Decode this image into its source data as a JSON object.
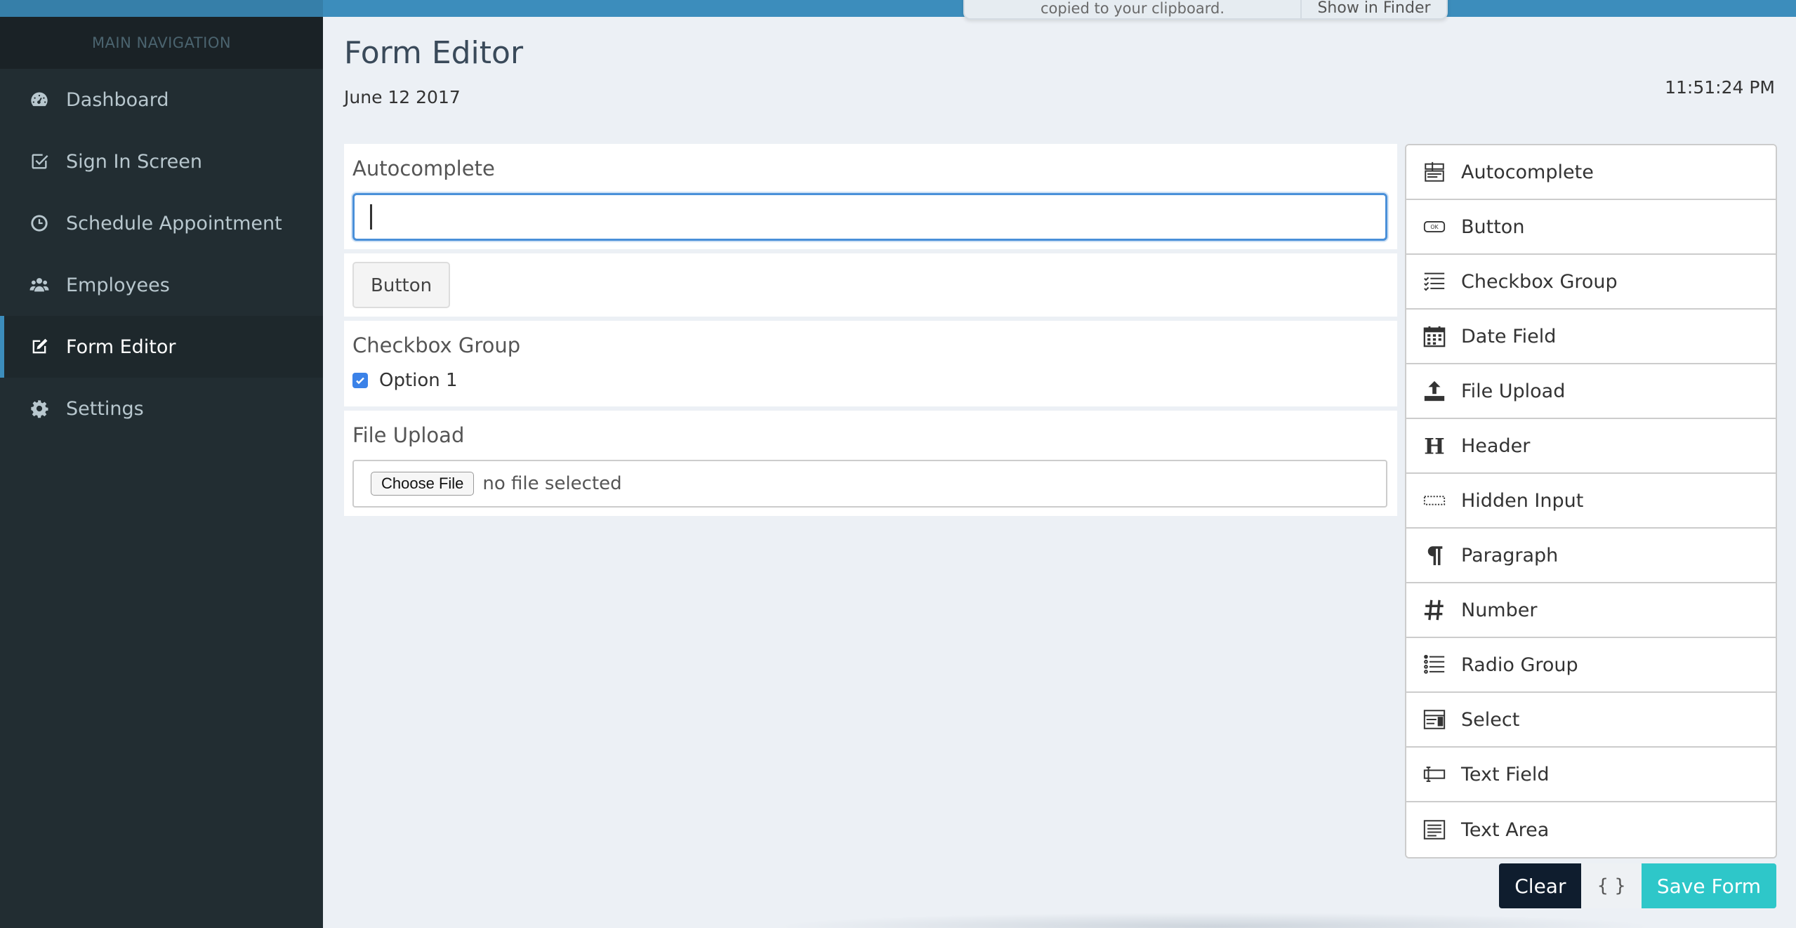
{
  "sidebar": {
    "header": "MAIN NAVIGATION",
    "items": [
      {
        "label": "Dashboard",
        "icon": "dashboard-icon"
      },
      {
        "label": "Sign In Screen",
        "icon": "check-square-icon"
      },
      {
        "label": "Schedule Appointment",
        "icon": "clock-icon"
      },
      {
        "label": "Employees",
        "icon": "users-icon"
      },
      {
        "label": "Form Editor",
        "icon": "edit-icon",
        "active": true
      },
      {
        "label": "Settings",
        "icon": "gear-icon"
      }
    ]
  },
  "header": {
    "title": "Form Editor",
    "date": "June 12 2017",
    "time": "11:51:24 PM"
  },
  "notification": {
    "text": "copied to your clipboard.",
    "action": "Show in Finder"
  },
  "stage": {
    "autocomplete": {
      "label": "Autocomplete",
      "value": ""
    },
    "button": {
      "label": "Button"
    },
    "checkbox_group": {
      "label": "Checkbox Group",
      "option": "Option 1",
      "checked": true
    },
    "file_upload": {
      "label": "File Upload",
      "button": "Choose File",
      "status": "no file selected"
    }
  },
  "palette": {
    "items": [
      {
        "label": "Autocomplete",
        "icon": "autocomplete-icon"
      },
      {
        "label": "Button",
        "icon": "button-icon"
      },
      {
        "label": "Checkbox Group",
        "icon": "checkbox-group-icon"
      },
      {
        "label": "Date Field",
        "icon": "calendar-icon"
      },
      {
        "label": "File Upload",
        "icon": "upload-icon"
      },
      {
        "label": "Header",
        "icon": "header-icon"
      },
      {
        "label": "Hidden Input",
        "icon": "hidden-input-icon"
      },
      {
        "label": "Paragraph",
        "icon": "paragraph-icon"
      },
      {
        "label": "Number",
        "icon": "hash-icon"
      },
      {
        "label": "Radio Group",
        "icon": "radio-group-icon"
      },
      {
        "label": "Select",
        "icon": "select-icon"
      },
      {
        "label": "Text Field",
        "icon": "text-field-icon"
      },
      {
        "label": "Text Area",
        "icon": "text-area-icon"
      }
    ]
  },
  "actions": {
    "clear": "Clear",
    "json": "{ }",
    "save": "Save Form"
  },
  "colors": {
    "sidebar_bg": "#222d32",
    "topbar": "#3c8dbc",
    "active_border": "#3c8dbc",
    "save_button": "#2ec7c9",
    "clear_button": "#0f1d2e"
  }
}
